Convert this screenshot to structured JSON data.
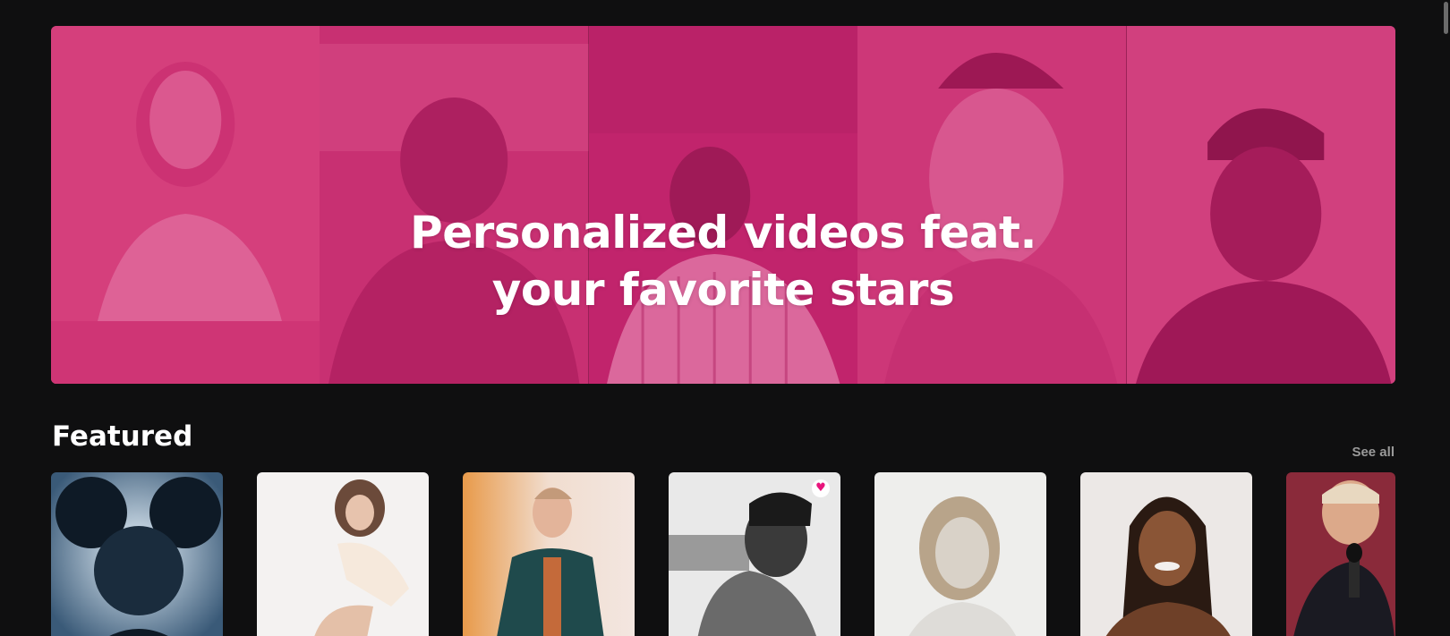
{
  "hero": {
    "headline_line1": "Personalized videos feat.",
    "headline_line2": "your favorite stars",
    "overlay_color": "#d61c6e"
  },
  "featured": {
    "title": "Featured",
    "see_all_label": "See all",
    "cards": [
      {
        "name": "deadmau5-style helmet portrait"
      },
      {
        "name": "seated woman portrait"
      },
      {
        "name": "man in green suit portrait"
      },
      {
        "name": "man black and white portrait",
        "favorited": true,
        "badge_icon": "heart-icon"
      },
      {
        "name": "blonde woman black and white portrait"
      },
      {
        "name": "smiling woman with braids portrait"
      },
      {
        "name": "man with microphone portrait"
      }
    ]
  },
  "colors": {
    "background": "#0f0f10",
    "accent_pink": "#e8157c",
    "muted_text": "#9a9a9a"
  }
}
